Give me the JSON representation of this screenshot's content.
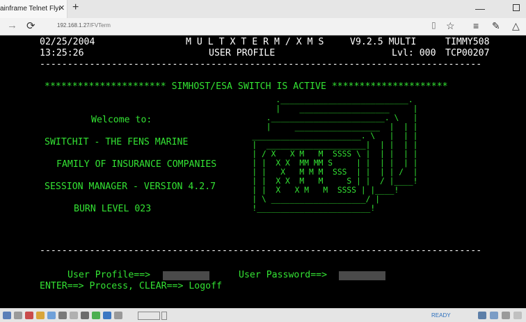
{
  "browser": {
    "tab_title": "ainframe Telnet Flynet",
    "tab_close": "✕",
    "new_tab": "+",
    "win_min": "—",
    "url_host": "192.168.1.27",
    "url_path": "/FVTerm",
    "icons": [
      "back-arrow-icon",
      "refresh-icon",
      "reading-view-icon",
      "favorite-star-icon",
      "hub-icon",
      "notes-pen-icon",
      "share-icon"
    ]
  },
  "terminal": {
    "date": "02/25/2004",
    "time": "13:25:26",
    "system": "M U L T X T E R M / X M S",
    "version": "V9.2.5 MULTI",
    "user": "TIMMY508",
    "screen_title": "USER PROFILE",
    "level": "Lvl: 000",
    "terminal_id": "TCP00207",
    "separator": "--------------------------------------------------------------------------------",
    "banner": "********************** SIMHOST/ESA SWITCH IS ACTIVE *********************",
    "welcome": "Welcome to:",
    "line1": "SWITCHIT - THE FENS MARINE",
    "line2": "FAMILY OF INSURANCE COMPANIES",
    "line3": "SESSION MANAGER - VERSION 4.2.7",
    "line4": "BURN LEVEL 023",
    "profile_label": "User Profile==>",
    "password_label": "User Password==>",
    "help": "ENTER==> Process, CLEAR==> Logoff"
  },
  "taskbar": {
    "status": "READY"
  },
  "colors": {
    "terminal_green": "#33e233",
    "terminal_bg": "#000000",
    "field_bg": "#4a4a4a"
  }
}
